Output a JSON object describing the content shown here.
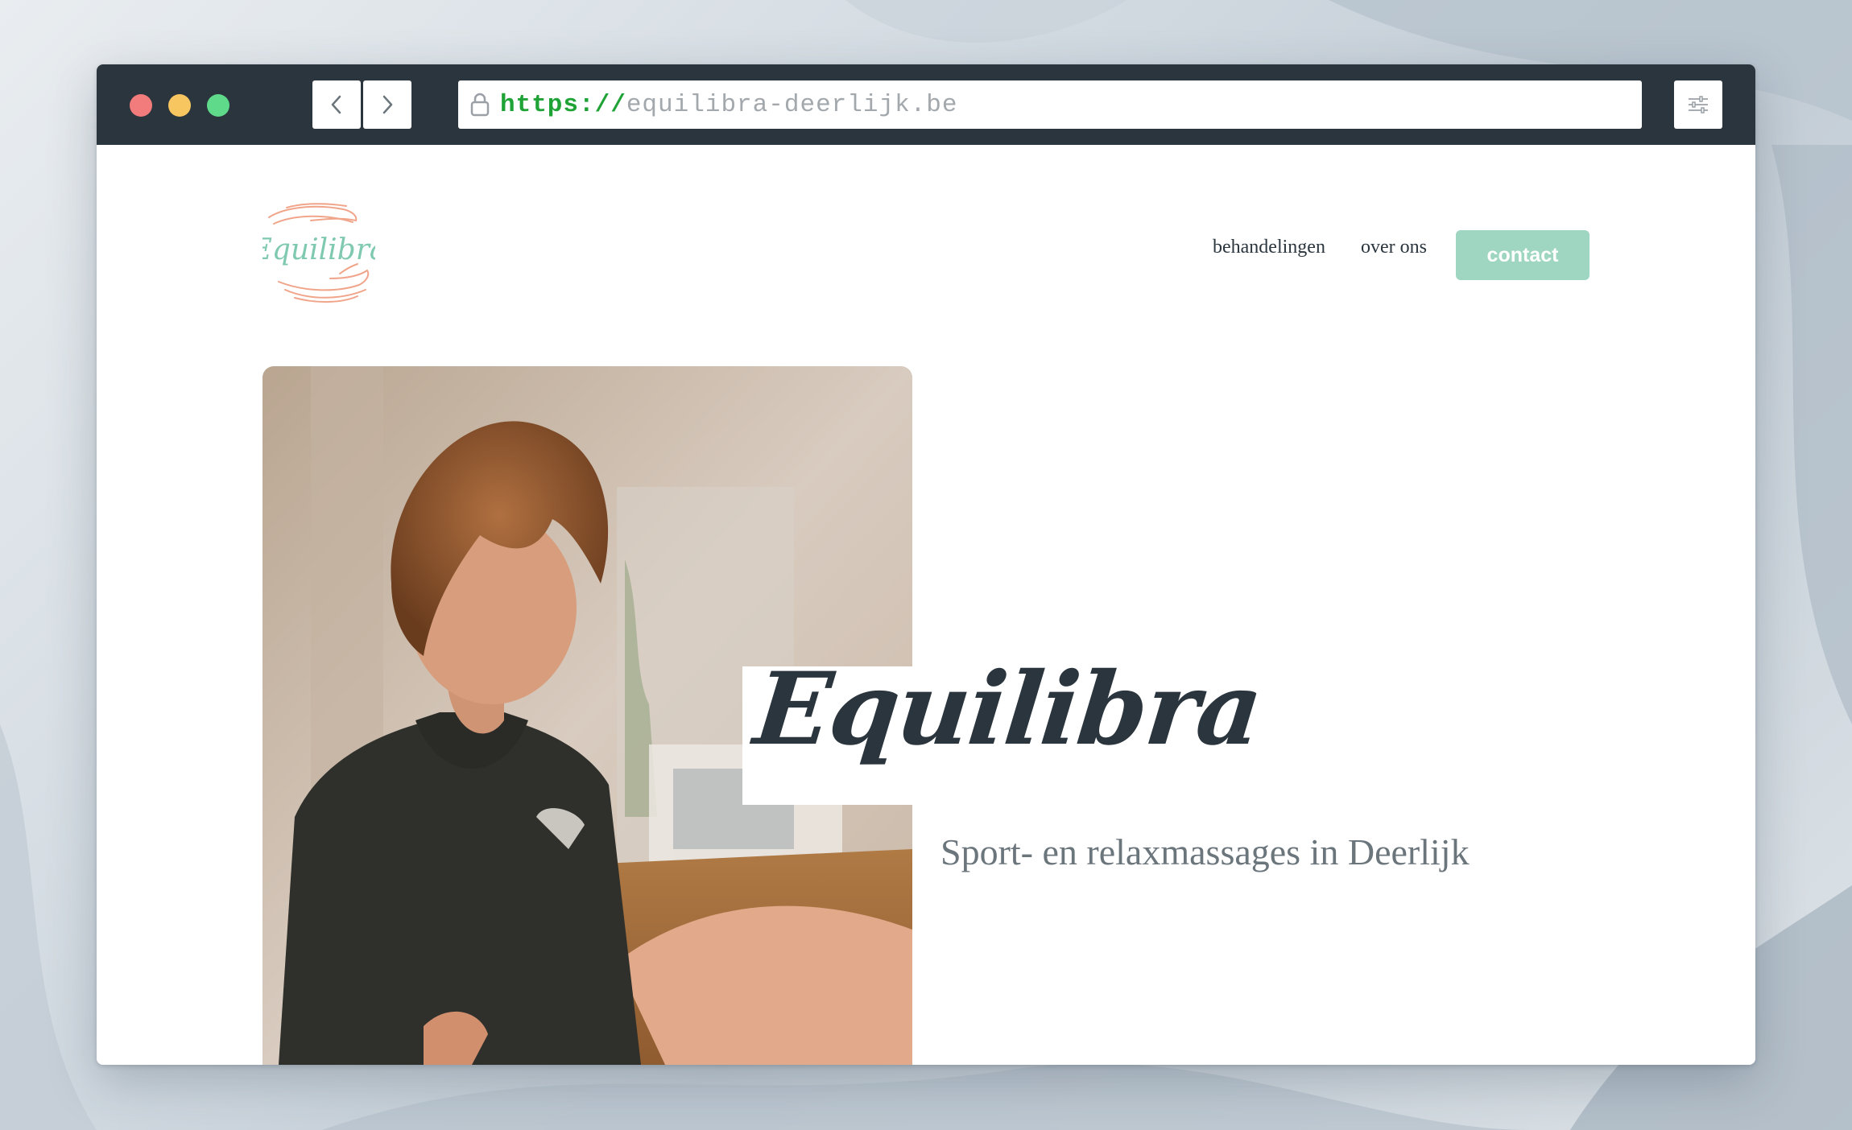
{
  "browser": {
    "url_scheme": "https://",
    "url_host": "equilibra-deerlijk.be",
    "icons": {
      "back": "chevron-left-icon",
      "forward": "chevron-right-icon",
      "lock": "lock-icon",
      "settings": "sliders-icon"
    }
  },
  "site": {
    "logo_text": "Equilibra",
    "nav": [
      {
        "label": "behandelingen"
      },
      {
        "label": "over ons"
      }
    ],
    "contact_label": "contact",
    "accent_color": "#9fd6c1",
    "logo_hand_color": "#f0a58a"
  },
  "hero": {
    "title": "Equilibra",
    "subtitle": "Sport- en relaxmassages in Deerlijk"
  }
}
